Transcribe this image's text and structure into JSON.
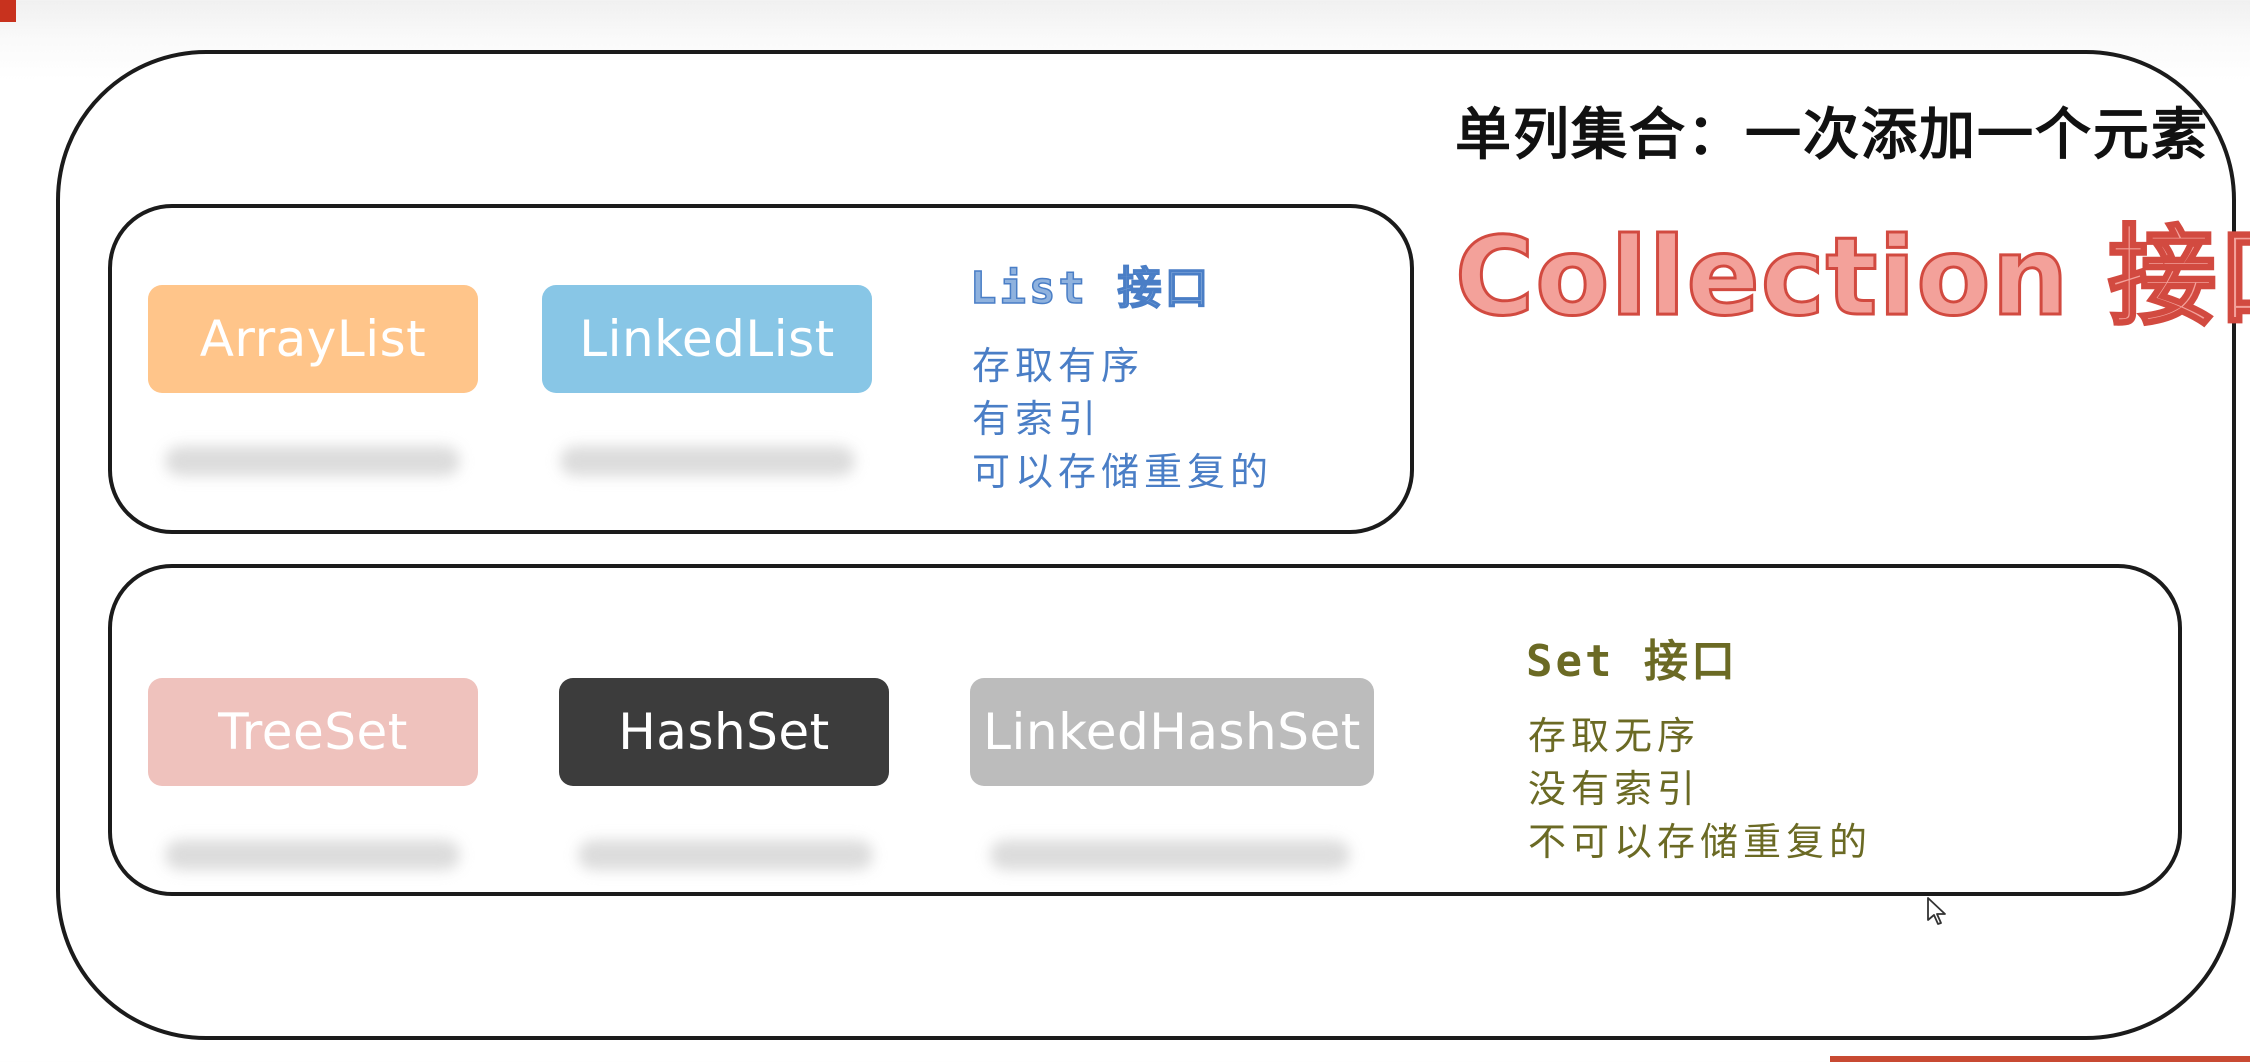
{
  "colors": {
    "arraylist": "#ffc58a",
    "linkedlist": "#88c6e6",
    "treeset": "#efc2bd",
    "hashset": "#3c3c3c",
    "linkedhashset": "#bcbcbc",
    "list_text": "#4a7ec6",
    "set_text": "#6b6a24",
    "collection_fill": "#f3a19a",
    "collection_stroke": "#d24a40"
  },
  "title": "单列集合：一次添加一个元素",
  "collection_label": "Collection 接口",
  "list_group": {
    "title": "List 接口",
    "features": [
      "存取有序",
      "有索引",
      "可以存储重复的"
    ],
    "classes": [
      "ArrayList",
      "LinkedList"
    ]
  },
  "set_group": {
    "title": "Set 接口",
    "features": [
      "存取无序",
      "没有索引",
      "不可以存储重复的"
    ],
    "classes": [
      "TreeSet",
      "HashSet",
      "LinkedHashSet"
    ]
  },
  "icons": {
    "cursor": "mouse-pointer-icon"
  }
}
